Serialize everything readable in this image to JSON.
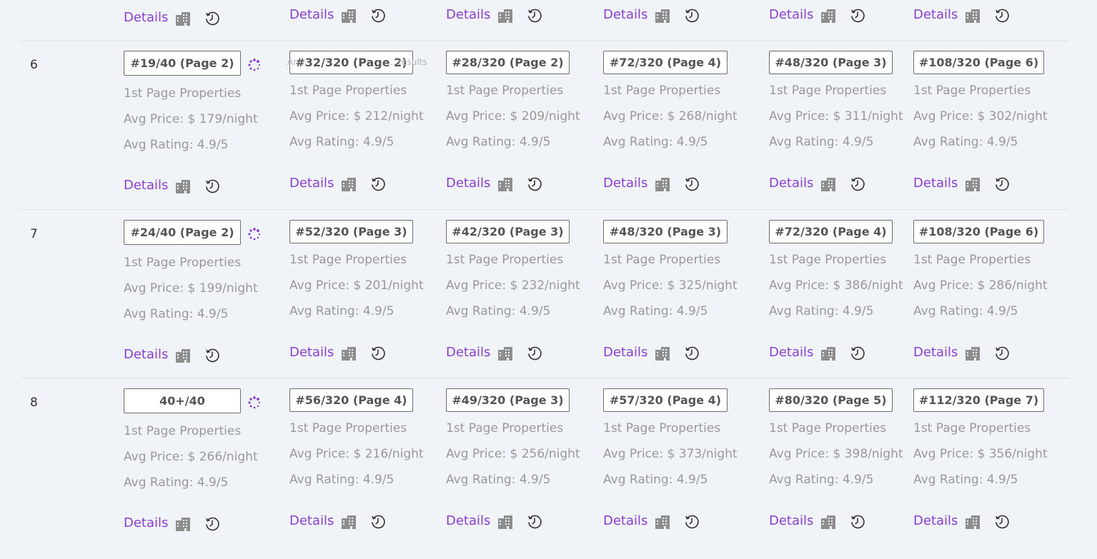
{
  "top_row": {
    "details_label": "Details"
  },
  "rows": [
    {
      "number": "6",
      "cells": [
        {
          "rank": "#19/40 (Page 2)",
          "props": "1st Page Properties",
          "price": "Avg Price: $ 179/night",
          "rating": "Avg Rating: 4.9/5",
          "details": "Details"
        },
        {
          "rank": "#32/320 (Page 2)",
          "props": "1st Page Properties",
          "price": "Avg Price: $ 212/night",
          "rating": "Avg Rating: 4.9/5",
          "details": "Details"
        },
        {
          "rank": "#28/320 (Page 2)",
          "props": "1st Page Properties",
          "price": "Avg Price: $ 209/night",
          "rating": "Avg Rating: 4.9/5",
          "details": "Details"
        },
        {
          "rank": "#72/320 (Page 4)",
          "props": "1st Page Properties",
          "price": "Avg Price: $ 268/night",
          "rating": "Avg Rating: 4.9/5",
          "details": "Details"
        },
        {
          "rank": "#48/320 (Page 3)",
          "props": "1st Page Properties",
          "price": "Avg Price: $ 311/night",
          "rating": "Avg Rating: 4.9/5",
          "details": "Details"
        },
        {
          "rank": "#108/320 (Page 6)",
          "props": "1st Page Properties",
          "price": "Avg Price: $ 302/night",
          "rating": "Avg Rating: 4.9/5",
          "details": "Details"
        }
      ]
    },
    {
      "number": "7",
      "cells": [
        {
          "rank": "#24/40 (Page 2)",
          "props": "1st Page Properties",
          "price": "Avg Price: $ 199/night",
          "rating": "Avg Rating: 4.9/5",
          "details": "Details"
        },
        {
          "rank": "#52/320 (Page 3)",
          "props": "1st Page Properties",
          "price": "Avg Price: $ 201/night",
          "rating": "Avg Rating: 4.9/5",
          "details": "Details"
        },
        {
          "rank": "#42/320 (Page 3)",
          "props": "1st Page Properties",
          "price": "Avg Price: $ 232/night",
          "rating": "Avg Rating: 4.9/5",
          "details": "Details"
        },
        {
          "rank": "#48/320 (Page 3)",
          "props": "1st Page Properties",
          "price": "Avg Price: $ 325/night",
          "rating": "Avg Rating: 4.9/5",
          "details": "Details"
        },
        {
          "rank": "#72/320 (Page 4)",
          "props": "1st Page Properties",
          "price": "Avg Price: $ 386/night",
          "rating": "Avg Rating: 4.9/5",
          "details": "Details"
        },
        {
          "rank": "#108/320 (Page 6)",
          "props": "1st Page Properties",
          "price": "Avg Price: $ 286/night",
          "rating": "Avg Rating: 4.9/5",
          "details": "Details"
        }
      ]
    },
    {
      "number": "8",
      "cells": [
        {
          "rank": "40+/40",
          "props": "1st Page Properties",
          "price": "Avg Price: $ 266/night",
          "rating": "Avg Rating: 4.9/5",
          "details": "Details"
        },
        {
          "rank": "#56/320 (Page 4)",
          "props": "1st Page Properties",
          "price": "Avg Price: $ 216/night",
          "rating": "Avg Rating: 4.9/5",
          "details": "Details"
        },
        {
          "rank": "#49/320 (Page 3)",
          "props": "1st Page Properties",
          "price": "Avg Price: $ 256/night",
          "rating": "Avg Rating: 4.9/5",
          "details": "Details"
        },
        {
          "rank": "#57/320 (Page 4)",
          "props": "1st Page Properties",
          "price": "Avg Price: $ 373/night",
          "rating": "Avg Rating: 4.9/5",
          "details": "Details"
        },
        {
          "rank": "#80/320 (Page 5)",
          "props": "1st Page Properties",
          "price": "Avg Price: $ 398/night",
          "rating": "Avg Rating: 4.9/5",
          "details": "Details"
        },
        {
          "rank": "#112/320 (Page 7)",
          "props": "1st Page Properties",
          "price": "Avg Price: $ 356/night",
          "rating": "Avg Rating: 4.9/5",
          "details": "Details"
        }
      ]
    }
  ],
  "ghost_labels": [
    "An...",
    "...results"
  ],
  "colors": {
    "accent": "#8a3fcf",
    "muted_text": "#999999",
    "icon_gray": "#8e8e8e",
    "background": "#f0f4f8"
  },
  "icons": {
    "building": "building-icon",
    "history": "history-icon",
    "loading": "loading-spinner-icon"
  }
}
